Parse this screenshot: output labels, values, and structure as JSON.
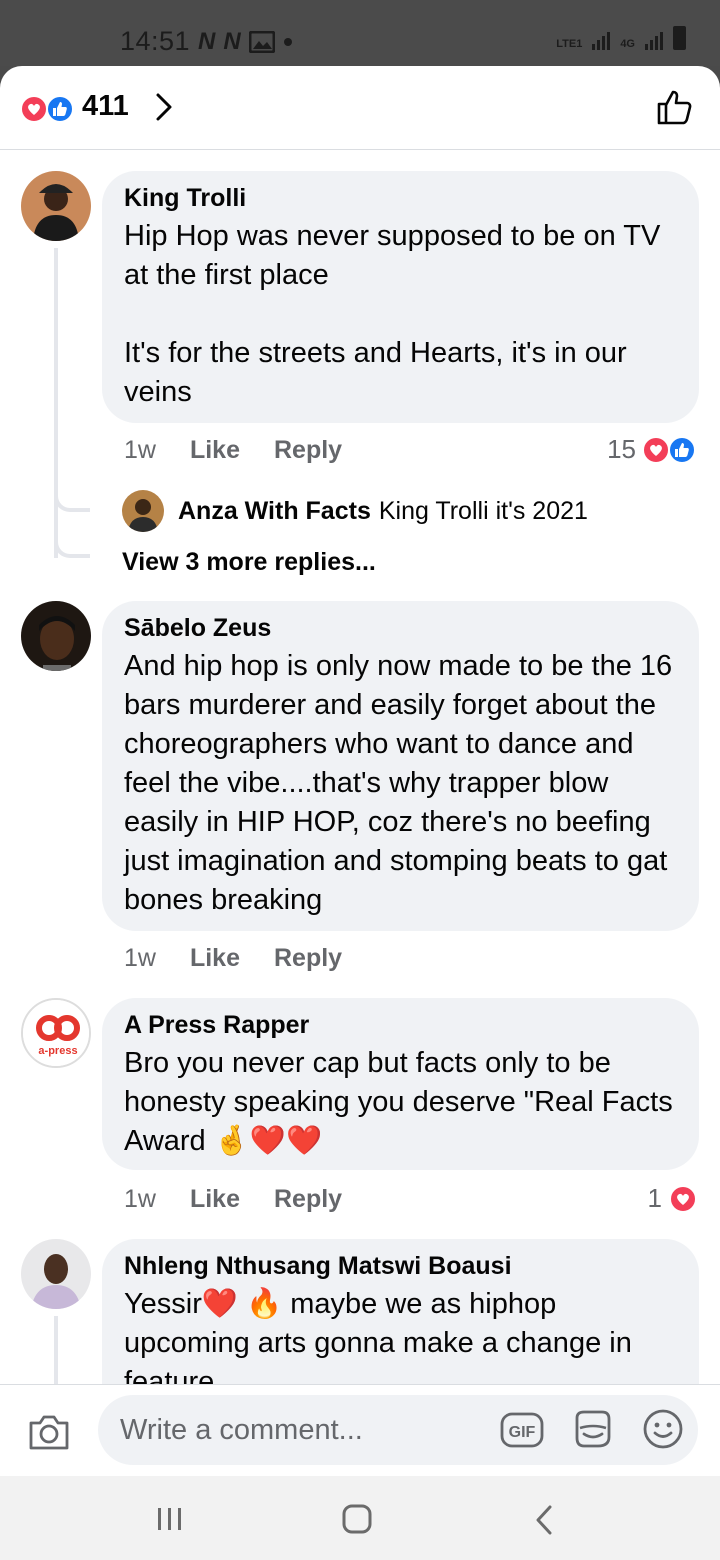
{
  "status_bar": {
    "time": "14:51",
    "left_icons": [
      "N",
      "N"
    ],
    "network_label_1": "LTE1",
    "network_label_2": "4G"
  },
  "header": {
    "reaction_count": "411",
    "reaction_icons": [
      "heart-reaction-icon",
      "like-reaction-icon"
    ]
  },
  "comments": [
    {
      "author": "King Trolli",
      "text": "Hip Hop was never supposed to be on TV at the first place\n\nIt's for the streets and Hearts, it's in our veins",
      "time": "1w",
      "like_label": "Like",
      "reply_label": "Reply",
      "reactions": "15",
      "replies": {
        "preview_author": "Anza With Facts",
        "preview_text": "King Trolli it's 2021",
        "view_more": "View 3 more replies..."
      }
    },
    {
      "author": "Sābelo Zeus",
      "text": "And hip hop is only now made to be the 16 bars murderer and easily forget about the choreographers who want to dance and feel the vibe....that's why trapper blow easily in HIP HOP, coz there's no beefing just imagination and stomping beats to gat bones breaking",
      "time": "1w",
      "like_label": "Like",
      "reply_label": "Reply"
    },
    {
      "author": "A Press Rapper",
      "text": "Bro you never cap but facts only to be honesty speaking you deserve \"Real Facts Award 🤞❤️❤️",
      "time": "1w",
      "like_label": "Like",
      "reply_label": "Reply",
      "reactions": "1",
      "avatar_text": "a-press"
    },
    {
      "author": "Nhleng Nthusang Matswi Boausi",
      "text": "Yessir❤️ 🔥 maybe we as hiphop upcoming arts gonna make a change in feature"
    }
  ],
  "composer": {
    "placeholder": "Write a comment...",
    "gif_label": "GIF"
  },
  "colors": {
    "heart": "#f33e58",
    "like": "#1877f2",
    "bubble": "#f0f2f5",
    "secondary_text": "#65676b"
  }
}
